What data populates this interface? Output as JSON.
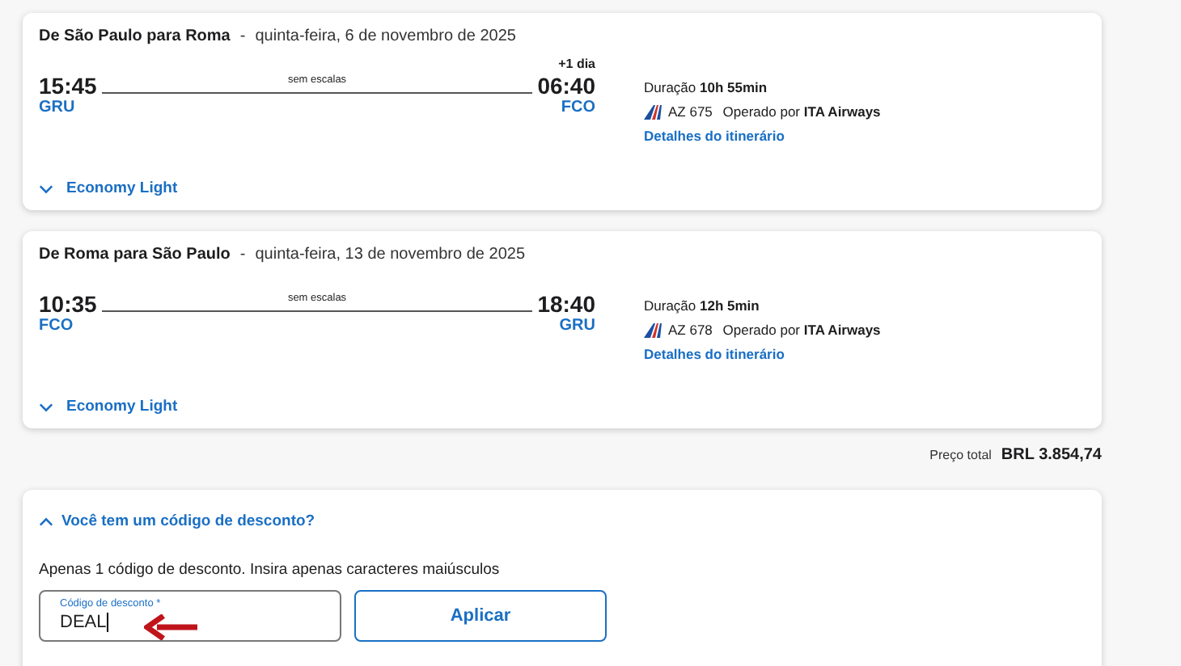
{
  "flights": [
    {
      "route": "De São Paulo para Roma",
      "separator": "-",
      "date": "quinta-feira, 6 de novembro de 2025",
      "depart_time": "15:45",
      "depart_airport": "GRU",
      "stops": "sem escalas",
      "day_offset": "+1 dia",
      "arrive_time": "06:40",
      "arrive_airport": "FCO",
      "duration_label": "Duração",
      "duration": "10h 55min",
      "flight_number": "AZ 675",
      "operated_label": "Operado por",
      "operator": "ITA Airways",
      "details_link": "Detalhes do itinerário",
      "fare": "Economy Light",
      "fare_expanded": false
    },
    {
      "route": "De Roma para São Paulo",
      "separator": "-",
      "date": "quinta-feira, 13 de novembro de 2025",
      "depart_time": "10:35",
      "depart_airport": "FCO",
      "stops": "sem escalas",
      "arrive_time": "18:40",
      "arrive_airport": "GRU",
      "duration_label": "Duração",
      "duration": "12h 5min",
      "flight_number": "AZ 678",
      "operated_label": "Operado por",
      "operator": "ITA Airways",
      "details_link": "Detalhes do itinerário",
      "fare": "Economy Light",
      "fare_expanded": false
    }
  ],
  "total": {
    "label": "Preço total",
    "value": "BRL 3.854,74"
  },
  "discount": {
    "toggle": "Você tem um código de desconto?",
    "expanded": true,
    "hint": "Apenas 1 código de desconto. Insira apenas caracteres maiúsculos",
    "field": {
      "label": "Código de desconto *",
      "value": "DEAL"
    },
    "button": "Aplicar"
  }
}
